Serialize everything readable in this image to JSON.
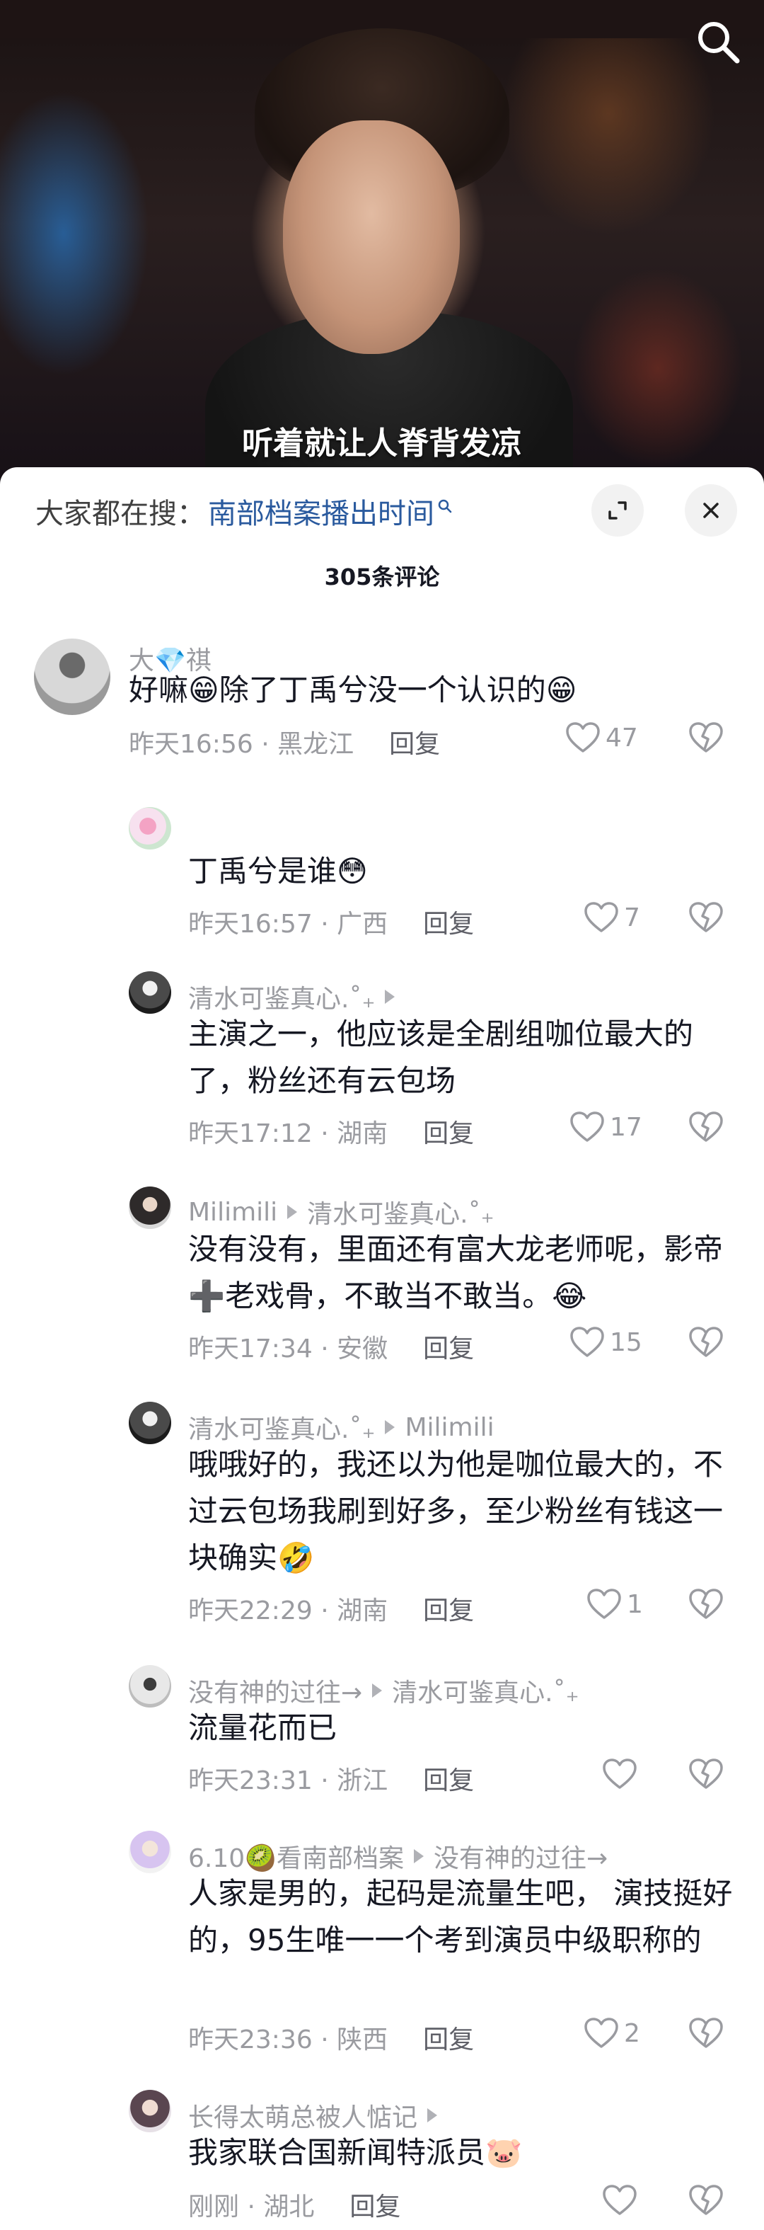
{
  "video": {
    "caption": "听着就让人脊背发凉"
  },
  "hot_search": {
    "label": "大家都在搜：",
    "term": "南部档案播出时间"
  },
  "comment_count": "305条评论",
  "comments": [
    {
      "name": "大💎祺",
      "text": "好嘛😁除了丁禹兮没一个认识的😁",
      "time": "昨天16:56",
      "location": "黑龙江",
      "reply_label": "回复",
      "likes": "47"
    },
    {
      "name": "",
      "text": "丁禹兮是谁😳",
      "time": "昨天16:57",
      "location": "广西",
      "reply_label": "回复",
      "likes": "7"
    },
    {
      "name": "清水可鉴真心.˚₊",
      "text": "主演之一，他应该是全剧组咖位最大的了，粉丝还有云包场",
      "time": "昨天17:12",
      "location": "湖南",
      "reply_label": "回复",
      "likes": "17"
    },
    {
      "name": "Milimili",
      "reply_to": "清水可鉴真心.˚₊",
      "text": "没有没有，里面还有富大龙老师呢，影帝➕老戏骨，不敢当不敢当。😂",
      "time": "昨天17:34",
      "location": "安徽",
      "reply_label": "回复",
      "likes": "15"
    },
    {
      "name": "清水可鉴真心.˚₊",
      "reply_to": "Milimili",
      "text": "哦哦好的，我还以为他是咖位最大的，不过云包场我刷到好多，至少粉丝有钱这一块确实🤣",
      "time": "昨天22:29",
      "location": "湖南",
      "reply_label": "回复",
      "likes": "1"
    },
    {
      "name": "没有神的过往→",
      "reply_to": "清水可鉴真心.˚₊",
      "text": "流量花而已",
      "time": "昨天23:31",
      "location": "浙江",
      "reply_label": "回复",
      "likes": ""
    },
    {
      "name": "6.10🥝看南部档案",
      "reply_to": "没有神的过往→",
      "text": "人家是男的，起码是流量生吧， 演技挺好的，95生唯一一个考到演员中级职称的",
      "time": "昨天23:36",
      "location": "陕西",
      "reply_label": "回复",
      "likes": "2"
    },
    {
      "name": "长得太萌总被人惦记",
      "text": "我家联合国新闻特派员🐷",
      "time": "刚刚",
      "location": "湖北",
      "reply_label": "回复",
      "likes": ""
    }
  ],
  "colors": {
    "link_blue": "#2a5a9e",
    "muted_gray": "#9a9ba0",
    "text_dark": "#161823"
  },
  "icons": [
    "search-icon",
    "expand-icon",
    "close-icon",
    "heart-icon",
    "broken-heart-icon",
    "magnifier-small-icon"
  ]
}
